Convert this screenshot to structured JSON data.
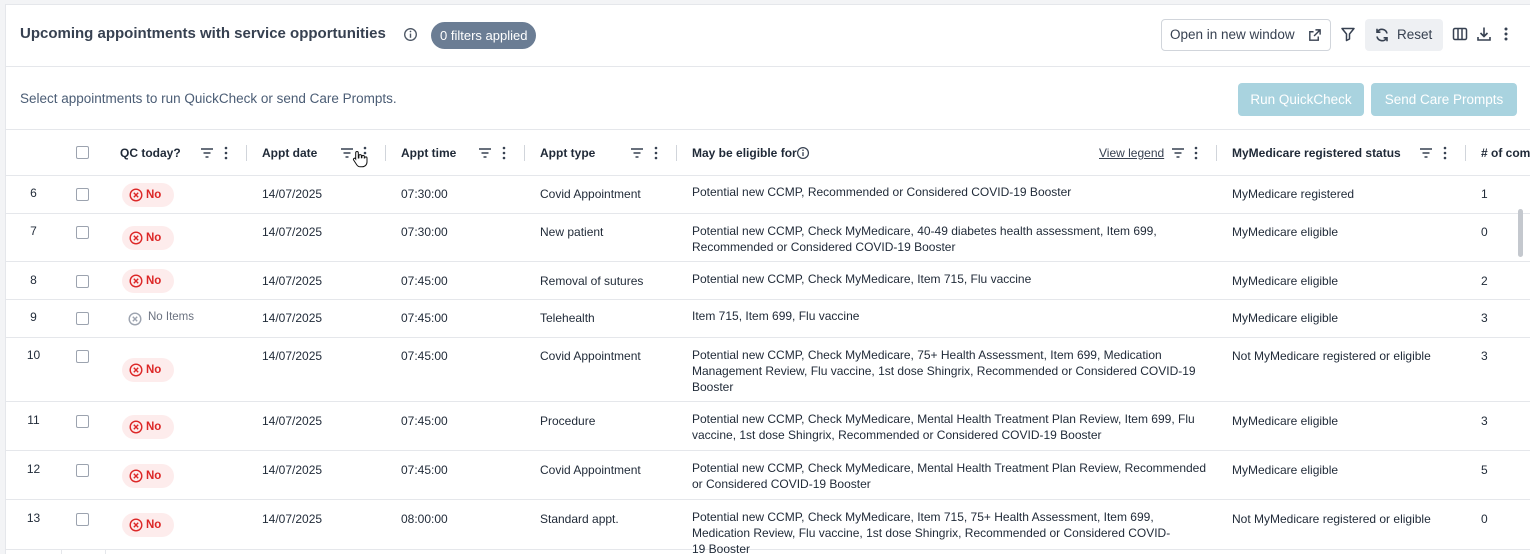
{
  "header": {
    "title": "Upcoming appointments with service opportunities",
    "filters_badge": "0 filters applied",
    "open_window_label": "Open in new window",
    "reset_label": "Reset"
  },
  "subbar": {
    "hint": "Select appointments to run QuickCheck or send Care Prompts.",
    "run_quickcheck_label": "Run QuickCheck",
    "send_care_prompts_label": "Send Care Prompts"
  },
  "table": {
    "columns": {
      "qc_today": "QC today?",
      "appt_date": "Appt date",
      "appt_time": "Appt time",
      "appt_type": "Appt type",
      "eligible": "May be eligible for",
      "view_legend": "View legend",
      "mymedicare": "MyMedicare registered status",
      "count": "# of com"
    },
    "rows": [
      {
        "num": "6",
        "qc": "No",
        "date": "14/07/2025",
        "time": "07:30:00",
        "type": "Covid Appointment",
        "eligible": "Potential new CCMP, Recommended or Considered COVID-19 Booster",
        "mymedicare": "MyMedicare registered",
        "count": "1"
      },
      {
        "num": "7",
        "qc": "No",
        "date": "14/07/2025",
        "time": "07:30:00",
        "type": "New patient",
        "eligible": "Potential new CCMP, Check MyMedicare, 40-49 diabetes health assessment, Item 699, Recommended or Considered COVID-19 Booster",
        "mymedicare": "MyMedicare eligible",
        "count": "0"
      },
      {
        "num": "8",
        "qc": "No",
        "date": "14/07/2025",
        "time": "07:45:00",
        "type": "Removal of sutures",
        "eligible": "Potential new CCMP, Check MyMedicare, Item 715, Flu vaccine",
        "mymedicare": "MyMedicare eligible",
        "count": "2"
      },
      {
        "num": "9",
        "qc": "No Items",
        "date": "14/07/2025",
        "time": "07:45:00",
        "type": "Telehealth",
        "eligible": "Item 715, Item 699, Flu vaccine",
        "mymedicare": "MyMedicare eligible",
        "count": "3"
      },
      {
        "num": "10",
        "qc": "No",
        "date": "14/07/2025",
        "time": "07:45:00",
        "type": "Covid Appointment",
        "eligible": "Potential new CCMP, Check MyMedicare, 75+ Health Assessment, Item 699, Medication Management Review, Flu vaccine, 1st dose Shingrix, Recommended or Considered COVID-19 Booster",
        "mymedicare": "Not MyMedicare registered or eligible",
        "count": "3"
      },
      {
        "num": "11",
        "qc": "No",
        "date": "14/07/2025",
        "time": "07:45:00",
        "type": "Procedure",
        "eligible": "Potential new CCMP, Check MyMedicare, Mental Health Treatment Plan Review, Item 699, Flu vaccine, 1st dose Shingrix, Recommended or Considered COVID-19 Booster",
        "mymedicare": "MyMedicare eligible",
        "count": "3"
      },
      {
        "num": "12",
        "qc": "No",
        "date": "14/07/2025",
        "time": "07:45:00",
        "type": "Covid Appointment",
        "eligible": "Potential new CCMP, Check MyMedicare, Mental Health Treatment Plan Review, Recommended or Considered COVID-19 Booster",
        "mymedicare": "MyMedicare eligible",
        "count": "5"
      },
      {
        "num": "13",
        "qc": "No",
        "date": "14/07/2025",
        "time": "08:00:00",
        "type": "Standard appt.",
        "eligible": "Potential new CCMP, Check MyMedicare, Item 715, 75+ Health Assessment, Item 699, Medication Review, Flu vaccine, 1st dose Shingrix, Recommended or Considered COVID-19 Booster",
        "mymedicare": "Not MyMedicare registered or eligible",
        "count": "0"
      }
    ]
  }
}
